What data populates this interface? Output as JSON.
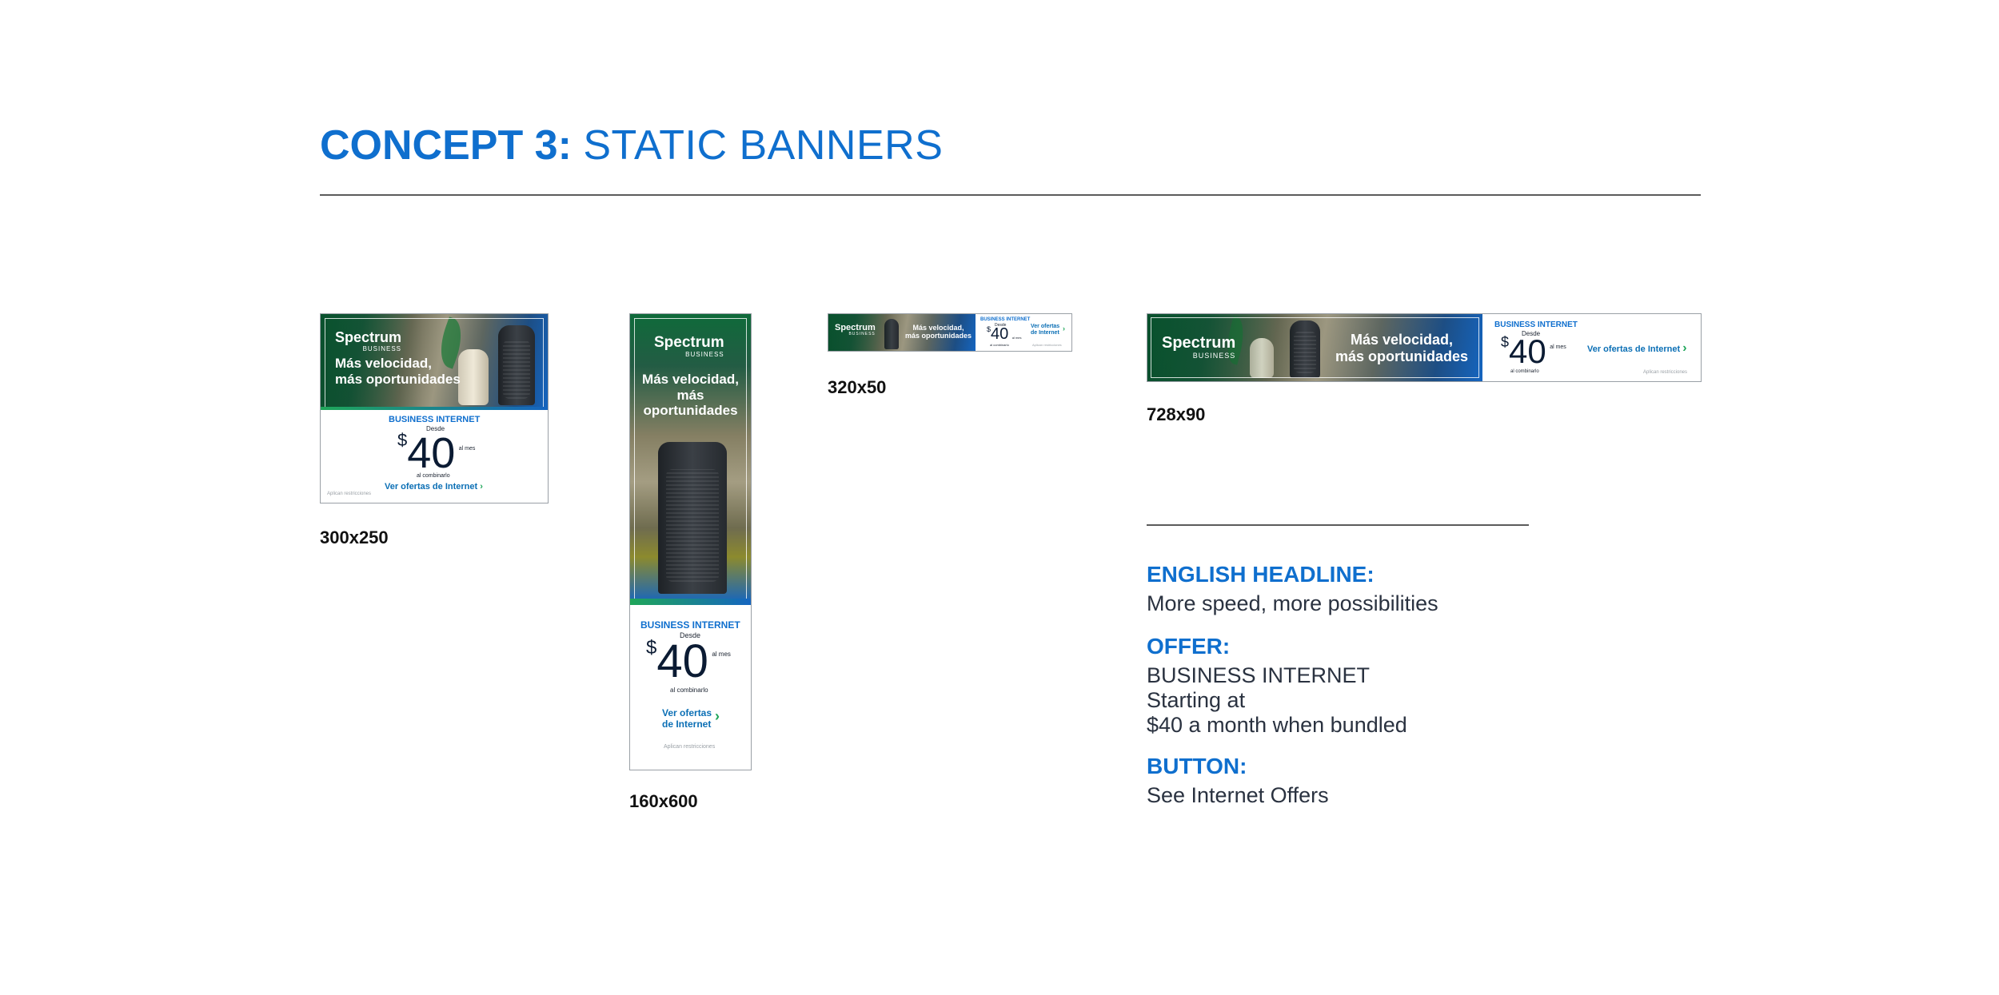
{
  "header": {
    "title_bold": "CONCEPT 3:",
    "title_light": "STATIC BANNERS"
  },
  "banner_common": {
    "brand": "Spectrum",
    "brand_sub": "BUSINESS",
    "headline_line1": "Más velocidad,",
    "headline_line2": "más oportunidades",
    "headline_vertical": "Más velocidad, más oportunidades",
    "product": "BUSINESS INTERNET",
    "desde": "Desde",
    "currency": "$",
    "price": "40",
    "per_month": "al mes",
    "bundled": "al combinarlo",
    "cta": "Ver ofertas de Internet",
    "cta_line1": "Ver ofertas",
    "cta_line2": "de Internet",
    "restrictions": "Aplican restricciones"
  },
  "sizes": {
    "s300x250": "300x250",
    "s160x600": "160x600",
    "s320x50": "320x50",
    "s728x90": "728x90"
  },
  "copy": {
    "english_headline_label": "ENGLISH HEADLINE:",
    "english_headline": "More speed, more possibilities",
    "offer_label": "OFFER:",
    "offer_text": "BUSINESS INTERNET\nStarting at\n$40 a month when bundled",
    "button_label": "BUTTON:",
    "button_text": "See Internet Offers"
  },
  "colors": {
    "accent_blue": "#0f6fce",
    "cta_green": "#1fa659",
    "brand_green": "#0d6b3b"
  }
}
